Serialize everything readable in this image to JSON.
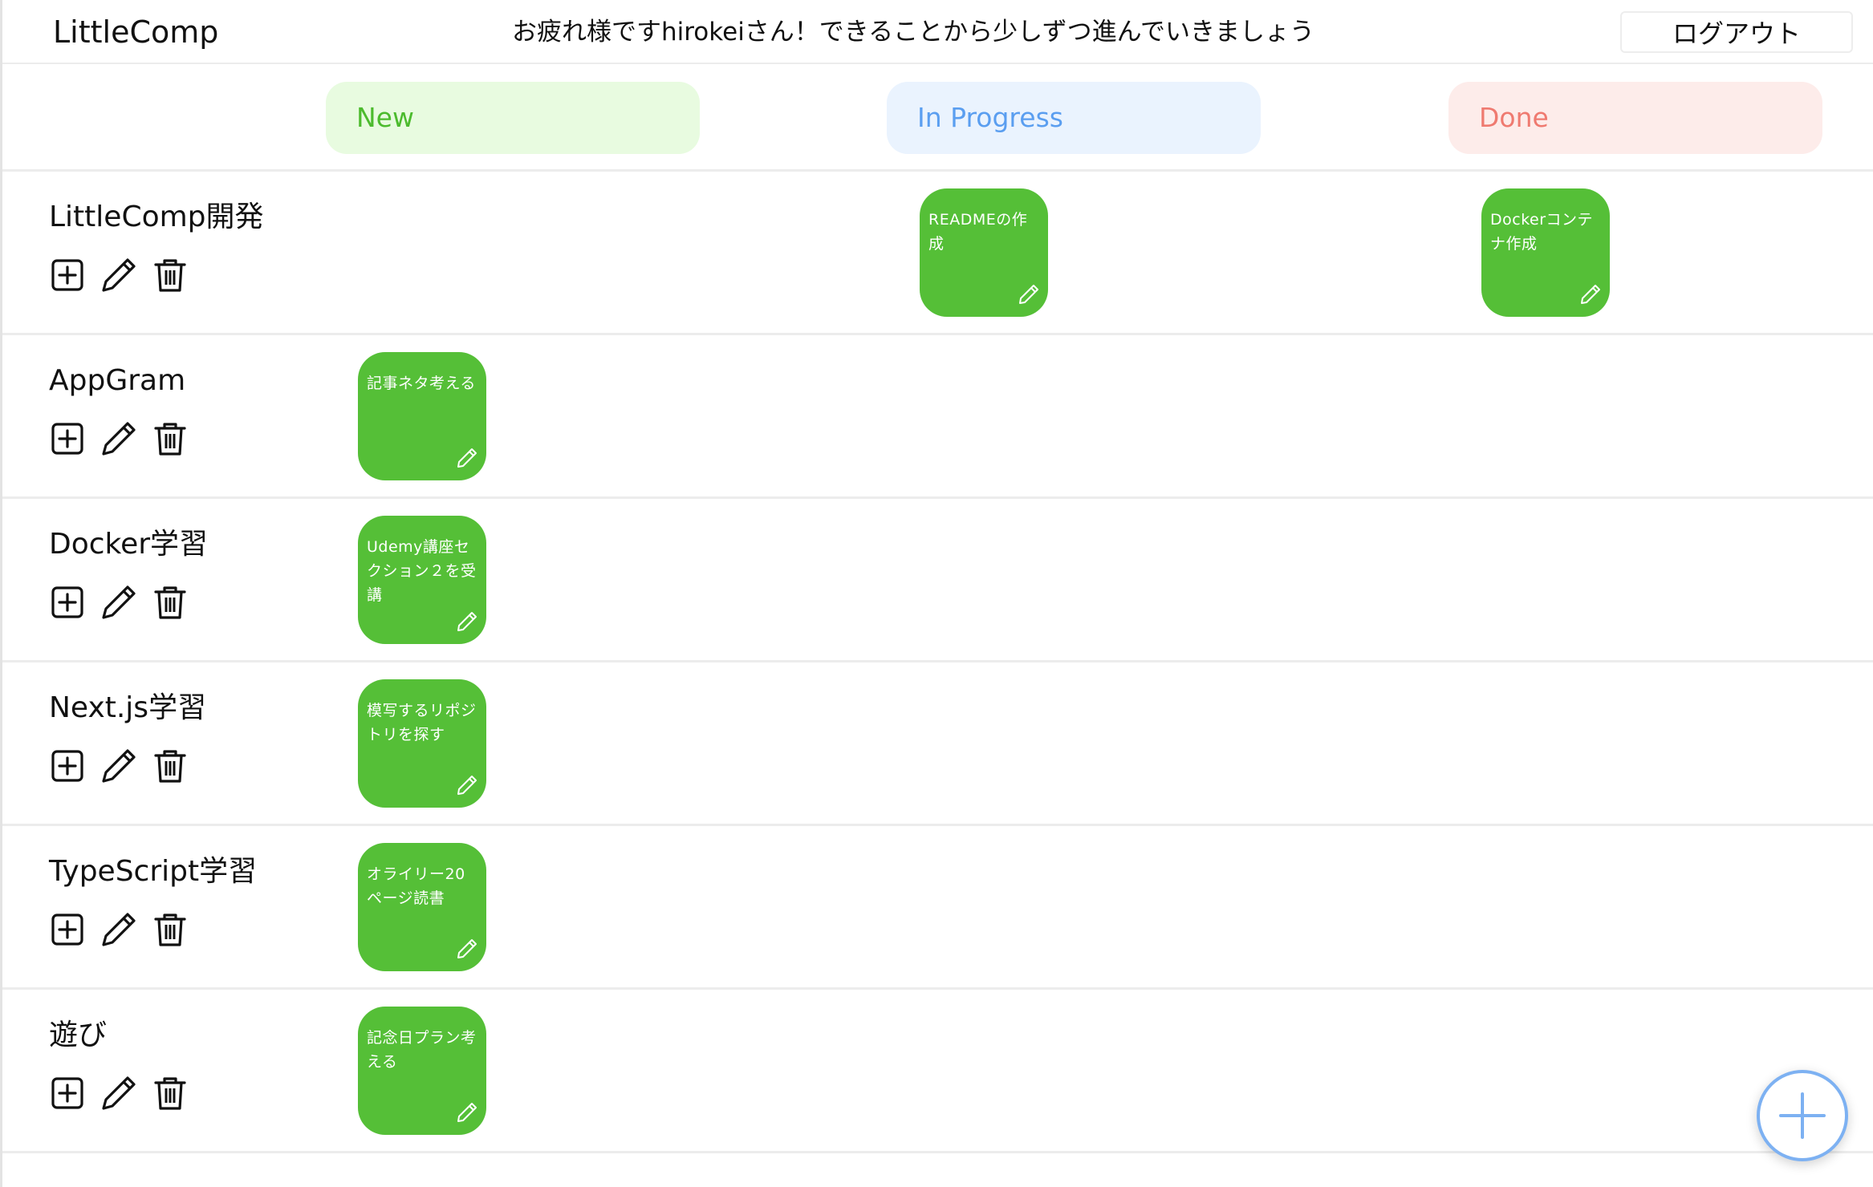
{
  "header": {
    "logo": "LittleComp",
    "greeting": "お疲れ様ですhirokeiさん！できることから少しずつ進んでいきましょう",
    "logout_label": "ログアウト"
  },
  "statuses": {
    "new": "New",
    "in_progress": "In Progress",
    "done": "Done"
  },
  "projects": [
    {
      "name": "LittleComp開発",
      "cards": {
        "new": "",
        "in_progress": "READMEの作成",
        "done": "Dockerコンテナ作成"
      }
    },
    {
      "name": "AppGram",
      "cards": {
        "new": "記事ネタ考える",
        "in_progress": "",
        "done": ""
      }
    },
    {
      "name": "Docker学習",
      "cards": {
        "new": "Udemy講座セクション２を受講",
        "in_progress": "",
        "done": ""
      }
    },
    {
      "name": "Next.js学習",
      "cards": {
        "new": "模写するリポジトリを探す",
        "in_progress": "",
        "done": ""
      }
    },
    {
      "name": "TypeScript学習",
      "cards": {
        "new": "オライリー20ページ読書",
        "in_progress": "",
        "done": ""
      }
    },
    {
      "name": "遊び",
      "cards": {
        "new": "記念日プラン考える",
        "in_progress": "",
        "done": ""
      }
    }
  ],
  "icons": {
    "add": "plus-square-icon",
    "edit": "pencil-icon",
    "delete": "trash-icon",
    "fab": "plus-circle-icon"
  },
  "colors": {
    "card_green": "#55bf37",
    "new_pill_bg": "#e8fbe0",
    "new_text": "#4cbb2e",
    "progress_pill_bg": "#eaf3fe",
    "progress_text": "#5a9ef0",
    "done_pill_bg": "#fdecea",
    "done_text": "#ef7a70",
    "fab_blue": "#7db1f2"
  }
}
